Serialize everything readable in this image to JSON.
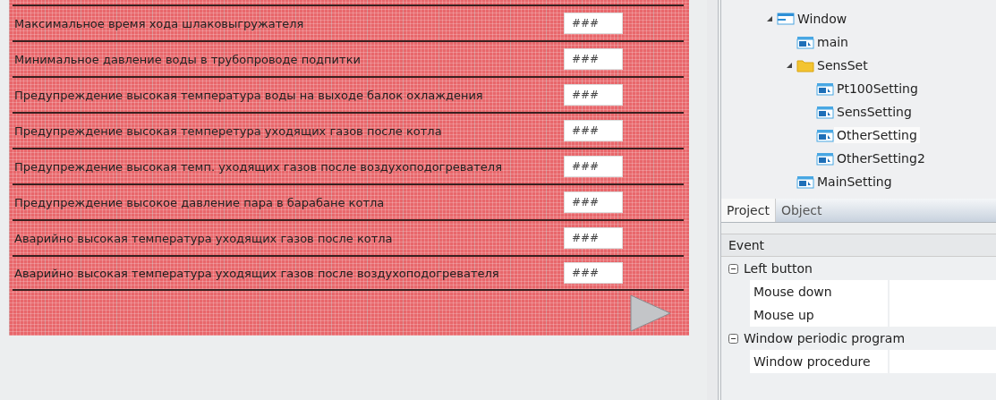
{
  "form": {
    "rows": [
      {
        "label": "Максимальное время хода шлаковыгружателя",
        "value": "###"
      },
      {
        "label": "Минимальное давление воды в трубопроводе подпитки",
        "value": "###"
      },
      {
        "label": "Предупреждение высокая температура воды на выходе балок охлаждения",
        "value": "###"
      },
      {
        "label": "Предупреждение высокая темперетура уходящих газов после котла",
        "value": "###"
      },
      {
        "label": "Предупреждение высокая темп. уходящих газов после воздухоподогревателя",
        "value": "###"
      },
      {
        "label": "Предупреждение высокое давление пара в барабане котла",
        "value": "###"
      },
      {
        "label": "Аварийно высокая температура уходящих газов после котла",
        "value": "###"
      },
      {
        "label": "Аварийно высокая температура уходящих газов после воздухоподогревателя",
        "value": "###"
      }
    ]
  },
  "tree": [
    {
      "label": "Window",
      "kind": "window",
      "expanded": true,
      "selected": false,
      "children": [
        {
          "label": "main",
          "kind": "screen",
          "selected": false
        },
        {
          "label": "SensSet",
          "kind": "folder",
          "expanded": true,
          "selected": false,
          "children": [
            {
              "label": "Pt100Setting",
              "kind": "screen",
              "selected": false
            },
            {
              "label": "SensSetting",
              "kind": "screen",
              "selected": false
            },
            {
              "label": "OtherSetting",
              "kind": "screen",
              "selected": true
            },
            {
              "label": "OtherSetting2",
              "kind": "screen",
              "selected": false
            }
          ]
        },
        {
          "label": "MainSetting",
          "kind": "screen",
          "selected": false
        }
      ]
    }
  ],
  "tabs": [
    {
      "label": "Project",
      "selected": true
    },
    {
      "label": "Object",
      "selected": false
    }
  ],
  "events": {
    "header": "Event",
    "groups": [
      {
        "label": "Left button",
        "expanded": true,
        "items": [
          {
            "name": "Mouse down"
          },
          {
            "name": "Mouse up"
          }
        ]
      },
      {
        "label": "Window periodic program",
        "expanded": true,
        "items": [
          {
            "name": "Window procedure"
          }
        ]
      }
    ]
  }
}
